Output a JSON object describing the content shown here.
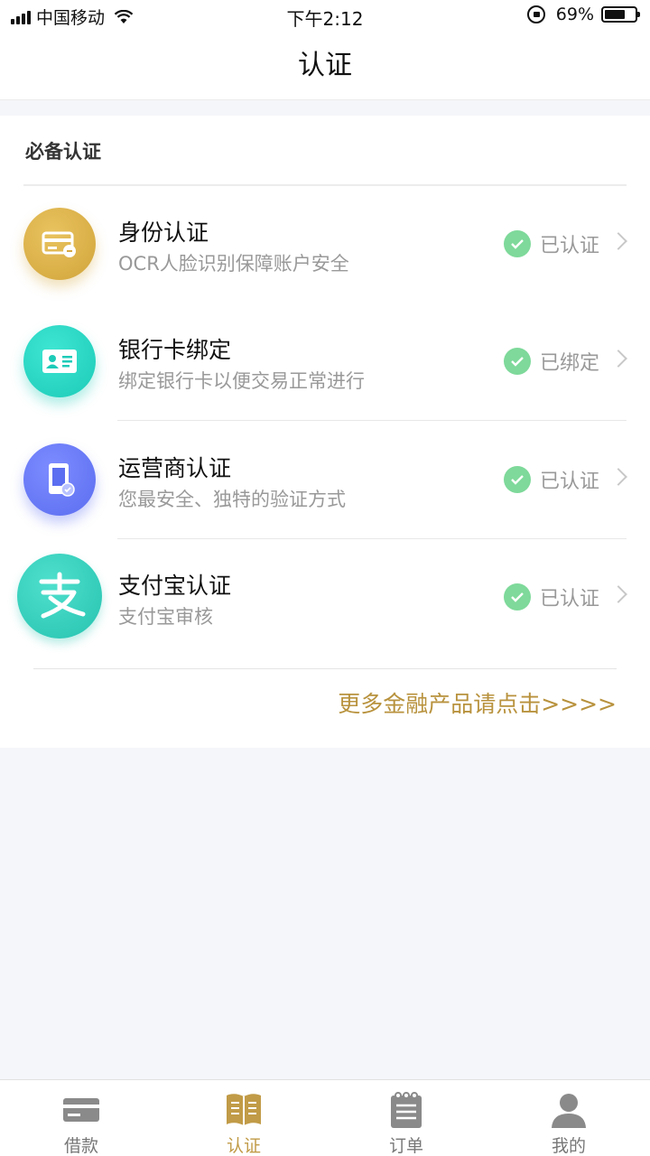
{
  "status_bar": {
    "carrier": "中国移动",
    "time": "下午2:12",
    "battery": "69%",
    "battery_level": 0.69
  },
  "nav": {
    "title": "认证"
  },
  "section": {
    "title": "必备认证"
  },
  "items": [
    {
      "name": "身份认证",
      "desc": "OCR人脸识别保障账户安全",
      "status": "已认证",
      "icon": "id-card-icon"
    },
    {
      "name": "银行卡绑定",
      "desc": "绑定银行卡以便交易正常进行",
      "status": "已绑定",
      "icon": "bank-card-icon"
    },
    {
      "name": "运营商认证",
      "desc": "您最安全、独特的验证方式",
      "status": "已认证",
      "icon": "phone-carrier-icon"
    },
    {
      "name": "支付宝认证",
      "desc": "支付宝审核",
      "status": "已认证",
      "icon": "alipay-icon"
    }
  ],
  "more_link": "更多金融产品请点击>>>>",
  "tabs": [
    {
      "label": "借款",
      "icon": "card-icon",
      "active": false
    },
    {
      "label": "认证",
      "icon": "book-icon",
      "active": true
    },
    {
      "label": "订单",
      "icon": "notepad-icon",
      "active": false
    },
    {
      "label": "我的",
      "icon": "person-icon",
      "active": false
    }
  ],
  "colors": {
    "accent": "#c19b47",
    "verified": "#7ed99a"
  }
}
